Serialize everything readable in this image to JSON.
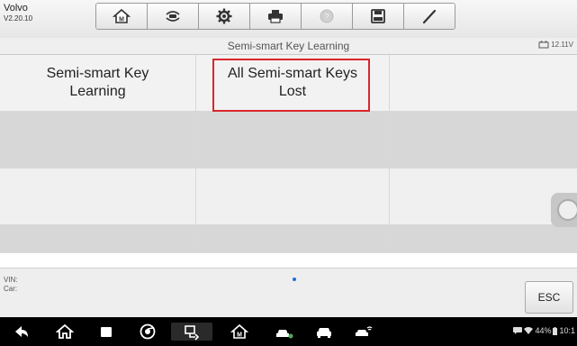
{
  "header": {
    "app_name": "Volvo",
    "version": "V2.20.10",
    "toolbar": [
      {
        "icon": "home-icon"
      },
      {
        "icon": "vehicle-swap-icon"
      },
      {
        "icon": "gear-icon"
      },
      {
        "icon": "printer-icon"
      },
      {
        "icon": "help-icon"
      },
      {
        "icon": "save-icon"
      },
      {
        "icon": "pen-icon"
      }
    ]
  },
  "subtitle": {
    "title": "Semi-smart Key Learning",
    "battery_voltage": "12.11V"
  },
  "menu": {
    "items": [
      "Semi-smart Key\nLearning",
      "All Semi-smart Keys\nLost"
    ],
    "highlight_color": "#d9262c"
  },
  "footer": {
    "vin_label": "VIN:",
    "car_label": "Car:",
    "esc_label": "ESC"
  },
  "system_bar": {
    "battery_percent": "44%",
    "time": "10:1",
    "icons": [
      "back-icon",
      "home-icon",
      "recent-apps-icon",
      "chrome-icon",
      "remote-icon",
      "diagnostics-home-icon",
      "car-service-icon",
      "car-icon",
      "car-scan-icon"
    ]
  }
}
